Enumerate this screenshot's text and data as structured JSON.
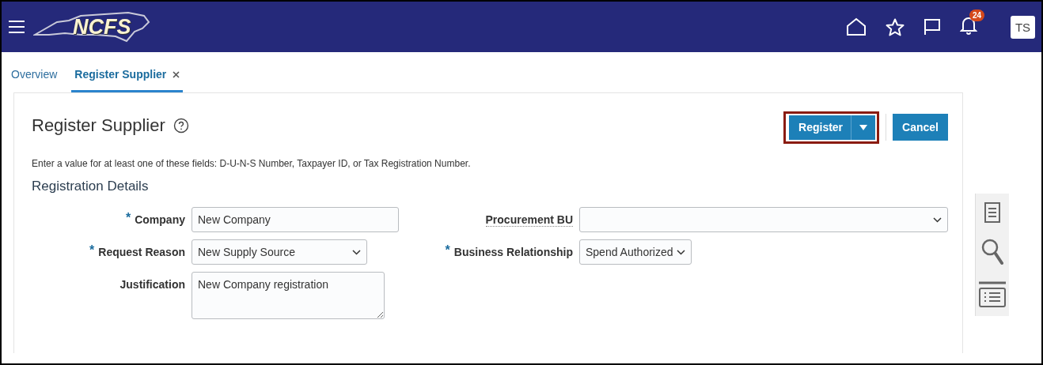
{
  "header": {
    "logo": "NCFS",
    "notifications": "24",
    "user_initials": "TS"
  },
  "tabs": [
    {
      "label": "Overview",
      "selected": false,
      "closable": false
    },
    {
      "label": "Register Supplier",
      "selected": true,
      "closable": true
    }
  ],
  "page": {
    "title": "Register Supplier",
    "instruction": "Enter a value for at least one of these fields: D-U-N-S Number, Taxpayer ID, or Tax Registration Number.",
    "section": "Registration Details"
  },
  "buttons": [
    {
      "label": "Register",
      "kind": "split",
      "highlighted": true
    },
    {
      "label": "Cancel",
      "kind": "plain",
      "highlighted": false
    }
  ],
  "fields_left": [
    {
      "label": "Company",
      "kind": "text",
      "required_mark": "*",
      "value": "New Company"
    },
    {
      "label": "Request Reason",
      "kind": "select",
      "required_mark": "*",
      "value": "New Supply Source"
    },
    {
      "label": "Justification",
      "kind": "textarea",
      "value": "New Company registration"
    }
  ],
  "fields_right": [
    {
      "label": "Procurement BU",
      "kind": "select-wide"
    },
    {
      "label": "Business Relationship",
      "kind": "select-small",
      "required_mark": "*",
      "value": "Spend Authorized"
    }
  ]
}
